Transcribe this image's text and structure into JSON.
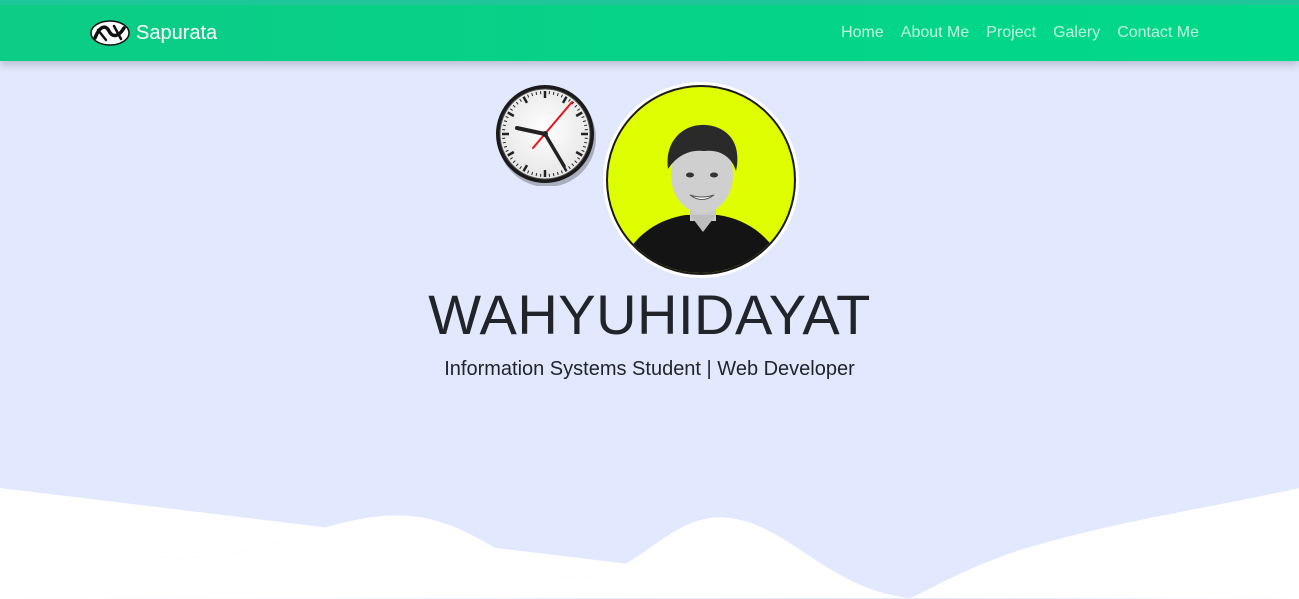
{
  "navbar": {
    "brand": "Sapurata",
    "links": [
      "Home",
      "About Me",
      "Project",
      "Galery",
      "Contact Me"
    ],
    "bg_color": "#00d98a"
  },
  "hero": {
    "name": "WAHYUHIDAYAT",
    "subtitle": "Information Systems Student | Web Developer",
    "bg_color": "#e2e8fe",
    "avatar_bg_color": "#dffe00"
  },
  "icons": {
    "brand": "brand-logo-icon",
    "clock": "analog-clock-icon"
  }
}
